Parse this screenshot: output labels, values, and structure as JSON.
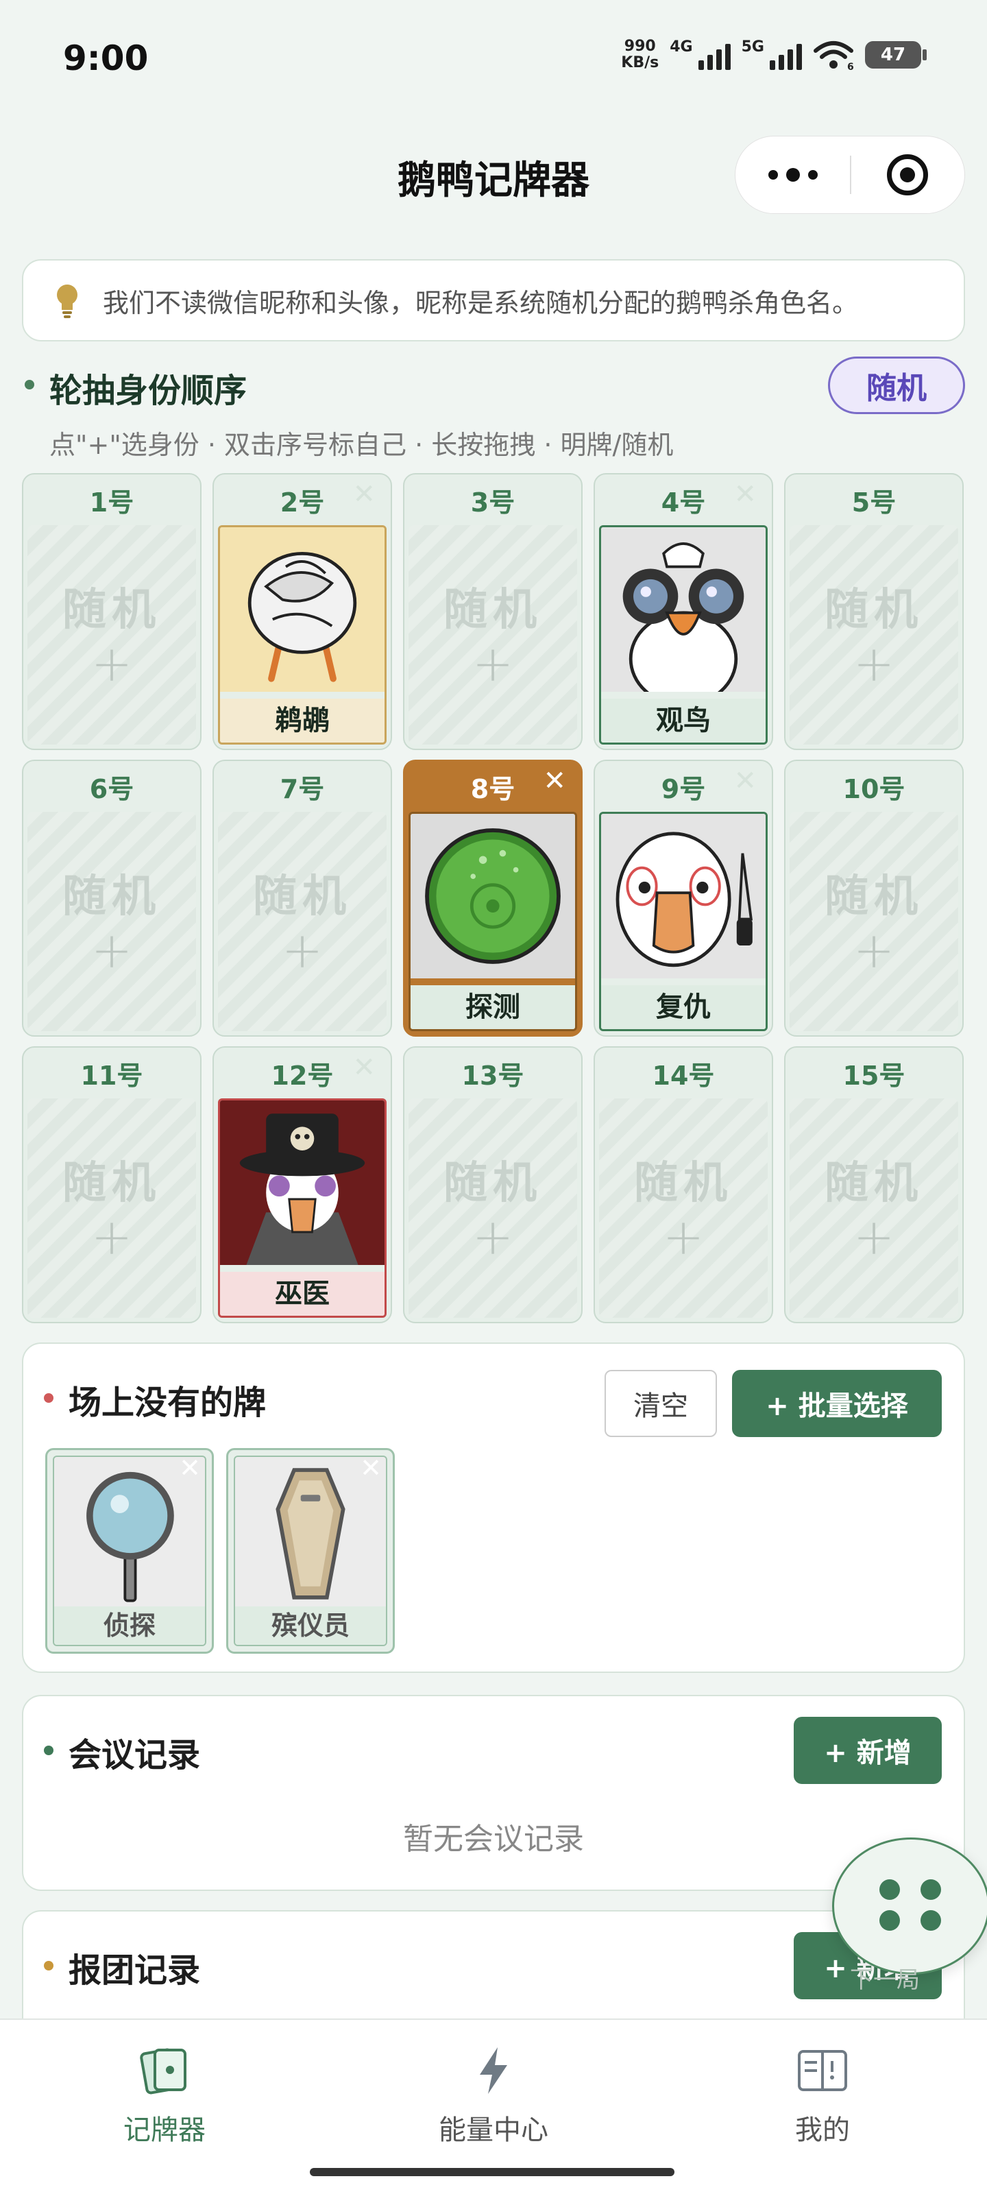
{
  "status_bar": {
    "time": "9:00",
    "net_speed_value": "990",
    "net_speed_unit": "KB/s",
    "sim1_label": "4G",
    "sim2_label": "5G",
    "wifi_badge": "6",
    "battery": "47"
  },
  "header": {
    "title": "鹅鸭记牌器"
  },
  "notice": {
    "icon": "lightbulb-icon",
    "text": "我们不读微信昵称和头像，昵称是系统随机分配的鹅鸭杀角色名。"
  },
  "rotation": {
    "title": "轮抽身份顺序",
    "mode_button": "随机",
    "hint": "点\"+\"选身份 · 双击序号标自己 · 长按拖拽 · 明牌/随机",
    "slots": [
      {
        "number": "1号",
        "empty_label": "随机",
        "add": "+"
      },
      {
        "number": "2号",
        "role": "鹈鹕",
        "remove": "✕"
      },
      {
        "number": "3号",
        "empty_label": "随机",
        "add": "+"
      },
      {
        "number": "4号",
        "role": "观鸟",
        "remove": "✕"
      },
      {
        "number": "5号",
        "empty_label": "随机",
        "add": "+"
      },
      {
        "number": "6号",
        "empty_label": "随机",
        "add": "+"
      },
      {
        "number": "7号",
        "empty_label": "随机",
        "add": "+"
      },
      {
        "number": "8号",
        "role": "探测",
        "remove": "✕",
        "selected": true
      },
      {
        "number": "9号",
        "role": "复仇",
        "remove": "✕"
      },
      {
        "number": "10号",
        "empty_label": "随机",
        "add": "+"
      },
      {
        "number": "11号",
        "empty_label": "随机",
        "add": "+"
      },
      {
        "number": "12号",
        "role": "巫医",
        "remove": "✕"
      },
      {
        "number": "13号",
        "empty_label": "随机",
        "add": "+"
      },
      {
        "number": "14号",
        "empty_label": "随机",
        "add": "+"
      },
      {
        "number": "15号",
        "empty_label": "随机",
        "add": "+"
      }
    ]
  },
  "absent_cards": {
    "title": "场上没有的牌",
    "clear_button": "清空",
    "batch_button": "+ 批量选择",
    "cards": [
      {
        "name": "侦探",
        "remove": "✕"
      },
      {
        "name": "殡仪员",
        "remove": "✕"
      }
    ]
  },
  "meeting_records": {
    "title": "会议记录",
    "add_button": "+ 新增",
    "empty_text": "暂无会议记录"
  },
  "team_records": {
    "title": "报团记录",
    "add_button": "+ 新增"
  },
  "fab": {
    "label": "下一局"
  },
  "bottom_nav": {
    "items": [
      {
        "label": "记牌器",
        "icon": "cards-icon",
        "active": true
      },
      {
        "label": "能量中心",
        "icon": "lightning-icon",
        "active": false
      },
      {
        "label": "我的",
        "icon": "book-icon",
        "active": false
      }
    ]
  },
  "colors": {
    "accent_green": "#3f7a58",
    "selected_orange": "#b9772f",
    "random_purple": "#5a48b8",
    "background": "#f0f5f2"
  }
}
